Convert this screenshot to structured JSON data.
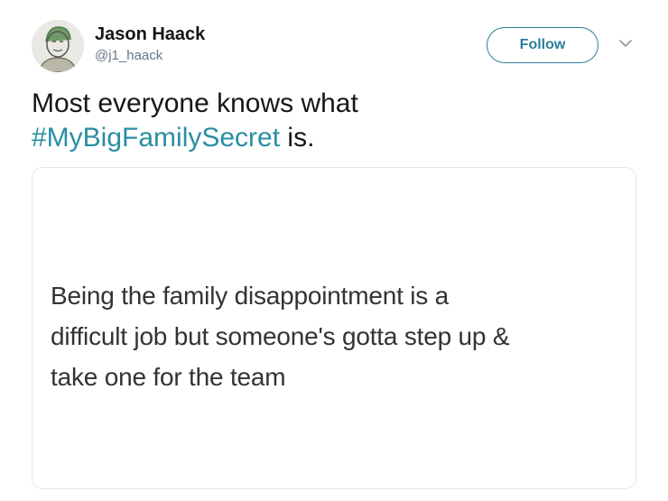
{
  "author": {
    "display_name": "Jason Haack",
    "handle": "@j1_haack"
  },
  "actions": {
    "follow_label": "Follow",
    "more_icon": "chevron-down-icon"
  },
  "tweet": {
    "text_before": "Most everyone knows what",
    "hashtag": "#MyBigFamilySecret",
    "text_after": " is."
  },
  "media": {
    "line1": "Being the family disappointment is a",
    "line2": "difficult job but someone's gotta step up &",
    "line3": "take one for the team"
  },
  "colors": {
    "accent": "#2c7e9b",
    "hashtag": "#2a8ea3",
    "text": "#14171a",
    "secondary": "#657786",
    "border": "#e1e8ed"
  }
}
